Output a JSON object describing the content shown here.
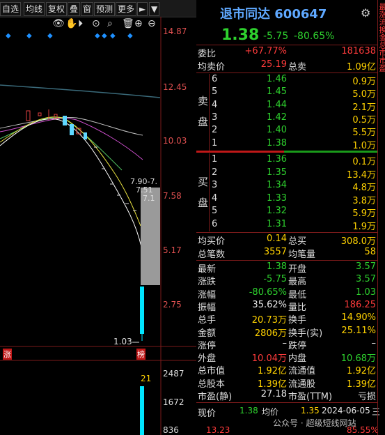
{
  "toolbar": {
    "items": [
      "自选",
      "均线",
      "复权",
      "叠",
      "窗",
      "预测",
      "更多"
    ],
    "play_icon": "►",
    "menu_icon": "▼"
  },
  "chart": {
    "price_labels": [
      "14.87",
      "12.45",
      "10.03",
      "7.58",
      "5.17",
      "2.75"
    ],
    "volume_labels": [
      "2487",
      "1672",
      "836"
    ],
    "low_label": "1.03",
    "annotation_labels": [
      "7.90-7.",
      "7.51",
      "7.1"
    ],
    "volume_count": "21",
    "bottom_left_value": "13.23",
    "bottom_right_value": "85.55%",
    "tag_left": "涨",
    "tag_right": "榜"
  },
  "quote": {
    "name": "退市同达",
    "code": "600647",
    "price": "1.38",
    "change": "-5.75",
    "change_pct": "-80.65%",
    "weibi_label": "委比",
    "weibi_pct": "+67.77%",
    "weibi_val": "181638",
    "avg_sell_label": "均卖价",
    "avg_sell": "25.19",
    "total_sell_label": "总卖",
    "total_sell": "1.09亿",
    "sell_side_label": "卖盘",
    "buy_side_label": "买盘",
    "sell": [
      {
        "lvl": "6",
        "price": "1.46",
        "vol": "0.9万"
      },
      {
        "lvl": "5",
        "price": "1.45",
        "vol": "5.0万"
      },
      {
        "lvl": "4",
        "price": "1.44",
        "vol": "2.1万"
      },
      {
        "lvl": "3",
        "price": "1.42",
        "vol": "0.5万"
      },
      {
        "lvl": "2",
        "price": "1.40",
        "vol": "5.5万"
      },
      {
        "lvl": "1",
        "price": "1.38",
        "vol": "1.0万"
      }
    ],
    "buy": [
      {
        "lvl": "1",
        "price": "1.36",
        "vol": "0.1万"
      },
      {
        "lvl": "2",
        "price": "1.35",
        "vol": "13.4万"
      },
      {
        "lvl": "3",
        "price": "1.34",
        "vol": "4.8万"
      },
      {
        "lvl": "4",
        "price": "1.33",
        "vol": "3.8万"
      },
      {
        "lvl": "5",
        "price": "1.32",
        "vol": "5.9万"
      },
      {
        "lvl": "6",
        "price": "1.31",
        "vol": "1.9万"
      }
    ],
    "avg_buy_label": "均买价",
    "avg_buy": "0.14",
    "total_buy_label": "总买",
    "total_buy": "308.0万",
    "total_trades_label": "总笔数",
    "total_trades": "3557",
    "avg_trade_label": "均笔量",
    "avg_trade": "58",
    "stats": [
      {
        "l1": "最新",
        "v1": "1.38",
        "c1": "grn",
        "l2": "开盘",
        "v2": "3.57",
        "c2": "grn"
      },
      {
        "l1": "涨跌",
        "v1": "-5.75",
        "c1": "grn",
        "l2": "最高",
        "v2": "3.57",
        "c2": "grn"
      },
      {
        "l1": "涨幅",
        "v1": "-80.65%",
        "c1": "grn",
        "l2": "最低",
        "v2": "1.03",
        "c2": "grn"
      },
      {
        "l1": "振幅",
        "v1": "35.62%",
        "c1": "wht",
        "l2": "量比",
        "v2": "186.25",
        "c2": "red"
      },
      {
        "l1": "总手",
        "v1": "20.73万",
        "c1": "yel",
        "l2": "换手",
        "v2": "14.90%",
        "c2": "yel"
      },
      {
        "l1": "金额",
        "v1": "2806万",
        "c1": "yel",
        "l2": "换手(实)",
        "v2": "25.11%",
        "c2": "yel"
      },
      {
        "l1": "涨停",
        "v1": "–",
        "c1": "wht",
        "l2": "跌停",
        "v2": "–",
        "c2": "wht"
      },
      {
        "l1": "外盘",
        "v1": "10.04万",
        "c1": "red",
        "l2": "内盘",
        "v2": "10.68万",
        "c2": "grn"
      },
      {
        "l1": "总市值",
        "v1": "1.92亿",
        "c1": "yel",
        "l2": "流通值",
        "v2": "1.92亿",
        "c2": "yel"
      },
      {
        "l1": "总股本",
        "v1": "1.39亿",
        "c1": "yel",
        "l2": "流通股",
        "v2": "1.39亿",
        "c2": "yel"
      },
      {
        "l1": "市盈(静)",
        "v1": "27.18",
        "c1": "wht",
        "l2": "市盈(TTM)",
        "v2": "亏损",
        "c2": "wht"
      }
    ],
    "now_label": "现价",
    "now_price": "1.38",
    "avg_label": "均价",
    "avg_price": "1.35",
    "date": "2024-06-05",
    "weekday": "三",
    "watermark": "公众号 · 超级短线网站"
  },
  "side_strip": "最涨流换金总市市盈"
}
